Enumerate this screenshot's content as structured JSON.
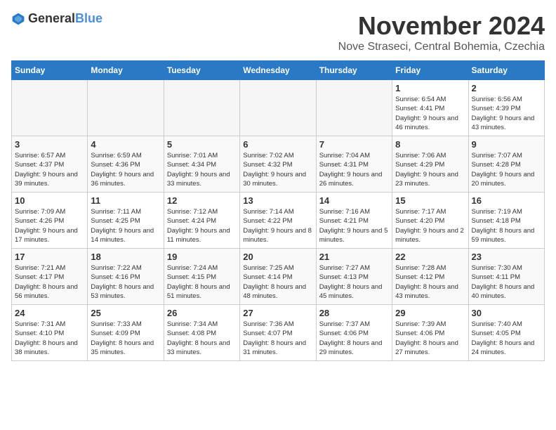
{
  "logo": {
    "text_general": "General",
    "text_blue": "Blue"
  },
  "title": "November 2024",
  "location": "Nove Straseci, Central Bohemia, Czechia",
  "days_of_week": [
    "Sunday",
    "Monday",
    "Tuesday",
    "Wednesday",
    "Thursday",
    "Friday",
    "Saturday"
  ],
  "weeks": [
    [
      {
        "day": "",
        "info": ""
      },
      {
        "day": "",
        "info": ""
      },
      {
        "day": "",
        "info": ""
      },
      {
        "day": "",
        "info": ""
      },
      {
        "day": "",
        "info": ""
      },
      {
        "day": "1",
        "info": "Sunrise: 6:54 AM\nSunset: 4:41 PM\nDaylight: 9 hours and 46 minutes."
      },
      {
        "day": "2",
        "info": "Sunrise: 6:56 AM\nSunset: 4:39 PM\nDaylight: 9 hours and 43 minutes."
      }
    ],
    [
      {
        "day": "3",
        "info": "Sunrise: 6:57 AM\nSunset: 4:37 PM\nDaylight: 9 hours and 39 minutes."
      },
      {
        "day": "4",
        "info": "Sunrise: 6:59 AM\nSunset: 4:36 PM\nDaylight: 9 hours and 36 minutes."
      },
      {
        "day": "5",
        "info": "Sunrise: 7:01 AM\nSunset: 4:34 PM\nDaylight: 9 hours and 33 minutes."
      },
      {
        "day": "6",
        "info": "Sunrise: 7:02 AM\nSunset: 4:32 PM\nDaylight: 9 hours and 30 minutes."
      },
      {
        "day": "7",
        "info": "Sunrise: 7:04 AM\nSunset: 4:31 PM\nDaylight: 9 hours and 26 minutes."
      },
      {
        "day": "8",
        "info": "Sunrise: 7:06 AM\nSunset: 4:29 PM\nDaylight: 9 hours and 23 minutes."
      },
      {
        "day": "9",
        "info": "Sunrise: 7:07 AM\nSunset: 4:28 PM\nDaylight: 9 hours and 20 minutes."
      }
    ],
    [
      {
        "day": "10",
        "info": "Sunrise: 7:09 AM\nSunset: 4:26 PM\nDaylight: 9 hours and 17 minutes."
      },
      {
        "day": "11",
        "info": "Sunrise: 7:11 AM\nSunset: 4:25 PM\nDaylight: 9 hours and 14 minutes."
      },
      {
        "day": "12",
        "info": "Sunrise: 7:12 AM\nSunset: 4:24 PM\nDaylight: 9 hours and 11 minutes."
      },
      {
        "day": "13",
        "info": "Sunrise: 7:14 AM\nSunset: 4:22 PM\nDaylight: 9 hours and 8 minutes."
      },
      {
        "day": "14",
        "info": "Sunrise: 7:16 AM\nSunset: 4:21 PM\nDaylight: 9 hours and 5 minutes."
      },
      {
        "day": "15",
        "info": "Sunrise: 7:17 AM\nSunset: 4:20 PM\nDaylight: 9 hours and 2 minutes."
      },
      {
        "day": "16",
        "info": "Sunrise: 7:19 AM\nSunset: 4:18 PM\nDaylight: 8 hours and 59 minutes."
      }
    ],
    [
      {
        "day": "17",
        "info": "Sunrise: 7:21 AM\nSunset: 4:17 PM\nDaylight: 8 hours and 56 minutes."
      },
      {
        "day": "18",
        "info": "Sunrise: 7:22 AM\nSunset: 4:16 PM\nDaylight: 8 hours and 53 minutes."
      },
      {
        "day": "19",
        "info": "Sunrise: 7:24 AM\nSunset: 4:15 PM\nDaylight: 8 hours and 51 minutes."
      },
      {
        "day": "20",
        "info": "Sunrise: 7:25 AM\nSunset: 4:14 PM\nDaylight: 8 hours and 48 minutes."
      },
      {
        "day": "21",
        "info": "Sunrise: 7:27 AM\nSunset: 4:13 PM\nDaylight: 8 hours and 45 minutes."
      },
      {
        "day": "22",
        "info": "Sunrise: 7:28 AM\nSunset: 4:12 PM\nDaylight: 8 hours and 43 minutes."
      },
      {
        "day": "23",
        "info": "Sunrise: 7:30 AM\nSunset: 4:11 PM\nDaylight: 8 hours and 40 minutes."
      }
    ],
    [
      {
        "day": "24",
        "info": "Sunrise: 7:31 AM\nSunset: 4:10 PM\nDaylight: 8 hours and 38 minutes."
      },
      {
        "day": "25",
        "info": "Sunrise: 7:33 AM\nSunset: 4:09 PM\nDaylight: 8 hours and 35 minutes."
      },
      {
        "day": "26",
        "info": "Sunrise: 7:34 AM\nSunset: 4:08 PM\nDaylight: 8 hours and 33 minutes."
      },
      {
        "day": "27",
        "info": "Sunrise: 7:36 AM\nSunset: 4:07 PM\nDaylight: 8 hours and 31 minutes."
      },
      {
        "day": "28",
        "info": "Sunrise: 7:37 AM\nSunset: 4:06 PM\nDaylight: 8 hours and 29 minutes."
      },
      {
        "day": "29",
        "info": "Sunrise: 7:39 AM\nSunset: 4:06 PM\nDaylight: 8 hours and 27 minutes."
      },
      {
        "day": "30",
        "info": "Sunrise: 7:40 AM\nSunset: 4:05 PM\nDaylight: 8 hours and 24 minutes."
      }
    ]
  ]
}
